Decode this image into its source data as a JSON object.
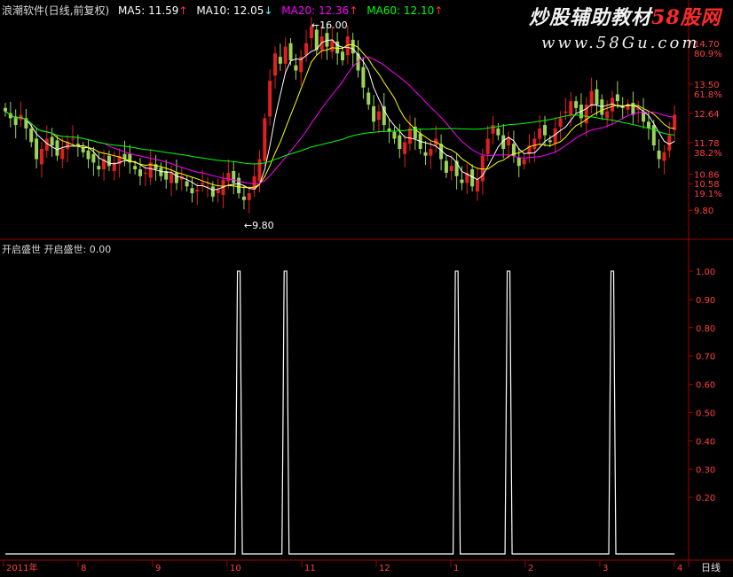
{
  "header": {
    "title": "浪潮软件(日线,前复权)",
    "ma5_label": "MA5: 11.59",
    "ma10_label": "MA10: 12.05",
    "ma20_label": "MA20: 12.36",
    "ma60_label": "MA60: 12.10",
    "arrow_up": "↑",
    "arrow_down": "↓"
  },
  "indicator": {
    "title": "开启盛世",
    "value_label": "开启盛世: 0.00"
  },
  "watermark": {
    "line1_a": "炒股辅助教材",
    "line1_b": "58股网",
    "line2": "www.58Gu.com"
  },
  "colors": {
    "ma5": "#ffffff",
    "ma10": "#ffff00",
    "ma20": "#ff00ff",
    "ma60": "#00ff00",
    "up": "#ff3232",
    "down": "#54fcfc",
    "candle_up": "#e02020",
    "candle_down": "#9ad45a",
    "axis": "#a00000",
    "axis_text": "#ff4040"
  },
  "chart_data": [
    {
      "type": "candlestick",
      "ylim": [
        9.0,
        15.5
      ],
      "y_ticks": [
        {
          "value": 14.7,
          "pct": "80.9%"
        },
        {
          "value": 13.5,
          "pct": "61.8%"
        },
        {
          "value": 12.64,
          "pct": ""
        },
        {
          "value": 11.78,
          "pct": "38.2%"
        },
        {
          "value": 10.86,
          "pct": ""
        },
        {
          "value": 10.58,
          "pct": "19.1%"
        },
        {
          "value": 9.8,
          "pct": ""
        }
      ],
      "x_labels": [
        "2011年",
        "8",
        "9",
        "10",
        "11",
        "12",
        "1",
        "2",
        "3",
        "4"
      ],
      "x_label_text": "日线",
      "annotations": [
        {
          "label": "16.00",
          "type": "high"
        },
        {
          "label": "9.80",
          "type": "low"
        }
      ],
      "close": [
        12.7,
        12.5,
        12.3,
        12.6,
        12.2,
        11.8,
        11.3,
        11.6,
        11.9,
        11.7,
        11.4,
        11.6,
        11.8,
        11.9,
        11.7,
        11.5,
        11.3,
        11.2,
        11.0,
        11.3,
        11.1,
        11.2,
        11.4,
        11.3,
        11.2,
        11.0,
        10.8,
        10.9,
        11.2,
        11.0,
        10.8,
        10.7,
        10.9,
        10.6,
        10.8,
        10.5,
        10.3,
        10.4,
        10.6,
        10.5,
        10.2,
        10.4,
        10.7,
        10.9,
        10.6,
        10.3,
        10.1,
        10.3,
        10.8,
        11.3,
        12.5,
        13.6,
        14.4,
        14.1,
        14.6,
        14.2,
        13.9,
        14.3,
        14.7,
        15.2,
        14.5,
        14.9,
        14.6,
        14.8,
        14.4,
        14.2,
        14.9,
        14.4,
        13.9,
        13.4,
        12.9,
        12.4,
        12.7,
        12.3,
        12.1,
        11.9,
        11.6,
        11.8,
        12.2,
        11.9,
        11.6,
        11.4,
        11.6,
        11.9,
        11.3,
        10.9,
        11.1,
        10.8,
        10.6,
        10.9,
        10.5,
        10.7,
        11.4,
        11.9,
        12.3,
        12.0,
        11.6,
        11.9,
        11.4,
        11.1,
        11.3,
        11.7,
        11.9,
        12.2,
        12.0,
        11.8,
        12.2,
        12.5,
        12.7,
        13.0,
        12.8,
        12.5,
        12.9,
        13.3,
        12.9,
        12.6,
        12.7,
        13.1,
        13.0,
        12.8,
        12.9,
        12.6,
        12.8,
        12.4,
        12.2,
        11.7,
        11.3,
        11.5,
        12.0,
        12.6
      ]
    },
    {
      "type": "line",
      "title": "开启盛世",
      "ylim": [
        0,
        1.05
      ],
      "y_ticks": [
        1.0,
        0.9,
        0.8,
        0.7,
        0.6,
        0.5,
        0.4,
        0.3,
        0.2
      ],
      "spike_indices": [
        45,
        54,
        87,
        97,
        117
      ],
      "baseline": 0.0
    }
  ]
}
